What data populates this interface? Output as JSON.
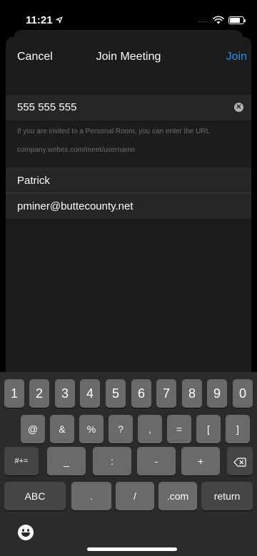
{
  "status": {
    "time": "11:21",
    "signal": "....",
    "battery_level": 0.8
  },
  "nav": {
    "cancel": "Cancel",
    "title": "Join Meeting",
    "join": "Join"
  },
  "form": {
    "meeting_number": "555 555 555",
    "hint_line1": "If you are invited to a Personal Room, you can enter the URL",
    "hint_line2": "company.webex.com/meet/username",
    "name": "Patrick",
    "email": "pminer@buttecounty.net"
  },
  "keyboard": {
    "row1": [
      "1",
      "2",
      "3",
      "4",
      "5",
      "6",
      "7",
      "8",
      "9",
      "0"
    ],
    "row2": [
      "@",
      "&",
      "%",
      "?",
      ",",
      "=",
      "[",
      "]"
    ],
    "row3_left": "#+=",
    "row3": [
      "_",
      ":",
      "-",
      "+"
    ],
    "row4": [
      "ABC",
      ".",
      "/",
      ".com",
      "return"
    ]
  },
  "colors": {
    "accent": "#2f8fe6",
    "sheet": "#1b1c1e",
    "field": "#252628",
    "keyboard": "#2b2b2d",
    "key": "#6a6a6d",
    "key_dark": "#454547"
  },
  "icons": [
    "location-arrow-icon",
    "wifi-icon",
    "battery-icon",
    "clear-icon",
    "delete-icon",
    "emoji-icon"
  ]
}
